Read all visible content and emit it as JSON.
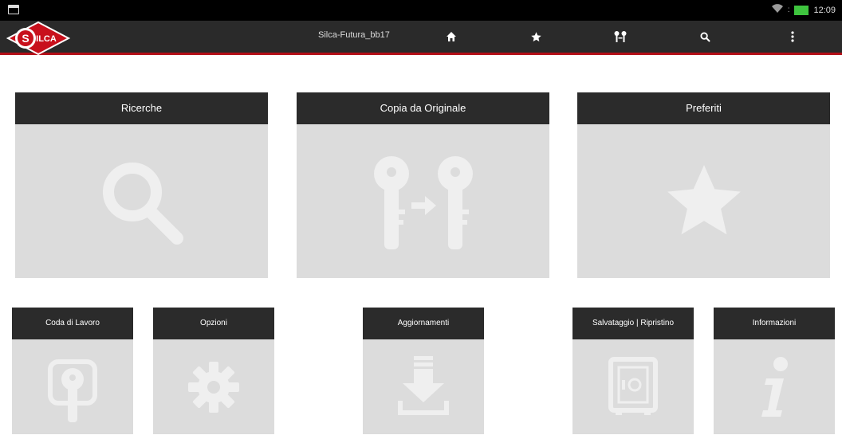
{
  "statusbar": {
    "time": "12:09"
  },
  "appbar": {
    "title": "Silca-Futura_bb17"
  },
  "tiles_large": [
    {
      "label": "Ricerche",
      "icon": "search-icon"
    },
    {
      "label": "Copia da Originale",
      "icon": "key-copy-icon"
    },
    {
      "label": "Preferiti",
      "icon": "star-icon"
    }
  ],
  "tiles_small": [
    {
      "label": "Coda di Lavoro",
      "icon": "work-queue-icon"
    },
    {
      "label": "Opzioni",
      "icon": "gear-icon"
    },
    {
      "label": "Aggiornamenti",
      "icon": "download-icon"
    },
    {
      "label": "Salvataggio | Ripristino",
      "icon": "safe-icon"
    },
    {
      "label": "Informazioni",
      "icon": "info-icon"
    }
  ],
  "colors": {
    "header": "#2b2b2b",
    "tile": "#dcdcdc",
    "accent": "#b30e17",
    "icon": "#efefef"
  }
}
